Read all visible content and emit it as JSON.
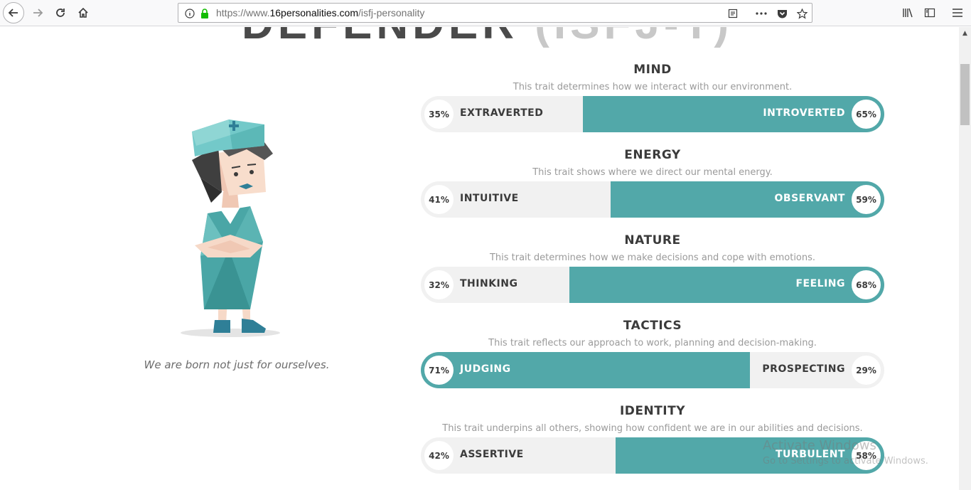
{
  "browser": {
    "url_prefix": "https://www.",
    "url_domain": "16personalities.com",
    "url_path": "/isfj-personality",
    "icons": [
      "back-icon",
      "forward-icon",
      "reload-icon",
      "home-icon",
      "info-icon",
      "lock-icon",
      "reader-view-icon",
      "more-icon",
      "pocket-icon",
      "bookmark-star-icon",
      "library-icon",
      "sidebar-icon",
      "menu-icon"
    ]
  },
  "heading": {
    "title": "DEFENDER",
    "code": "(ISFJ-T)"
  },
  "quote": "We are born not just for ourselves.",
  "traits": [
    {
      "title": "MIND",
      "description": "This trait determines how we interact with our environment.",
      "left_label": "EXTRAVERTED",
      "left_pct": "35%",
      "right_label": "INTROVERTED",
      "right_pct": "65%",
      "dominant": "right",
      "dominant_value": 65
    },
    {
      "title": "ENERGY",
      "description": "This trait shows where we direct our mental energy.",
      "left_label": "INTUITIVE",
      "left_pct": "41%",
      "right_label": "OBSERVANT",
      "right_pct": "59%",
      "dominant": "right",
      "dominant_value": 59
    },
    {
      "title": "NATURE",
      "description": "This trait determines how we make decisions and cope with emotions.",
      "left_label": "THINKING",
      "left_pct": "32%",
      "right_label": "FEELING",
      "right_pct": "68%",
      "dominant": "right",
      "dominant_value": 68
    },
    {
      "title": "TACTICS",
      "description": "This trait reflects our approach to work, planning and decision-making.",
      "left_label": "JUDGING",
      "left_pct": "71%",
      "right_label": "PROSPECTING",
      "right_pct": "29%",
      "dominant": "left",
      "dominant_value": 71
    },
    {
      "title": "IDENTITY",
      "description": "This trait underpins all others, showing how confident we are in our abilities and decisions.",
      "left_label": "ASSERTIVE",
      "left_pct": "42%",
      "right_label": "TURBULENT",
      "right_pct": "58%",
      "dominant": "right",
      "dominant_value": 58
    }
  ],
  "watermark": {
    "line1": "Activate Windows",
    "line2": "Go to Settings to activate Windows."
  },
  "colors": {
    "accent": "#52a8a9",
    "bar_bg": "#f1f1f1",
    "text_dark": "#3b3b3b"
  }
}
